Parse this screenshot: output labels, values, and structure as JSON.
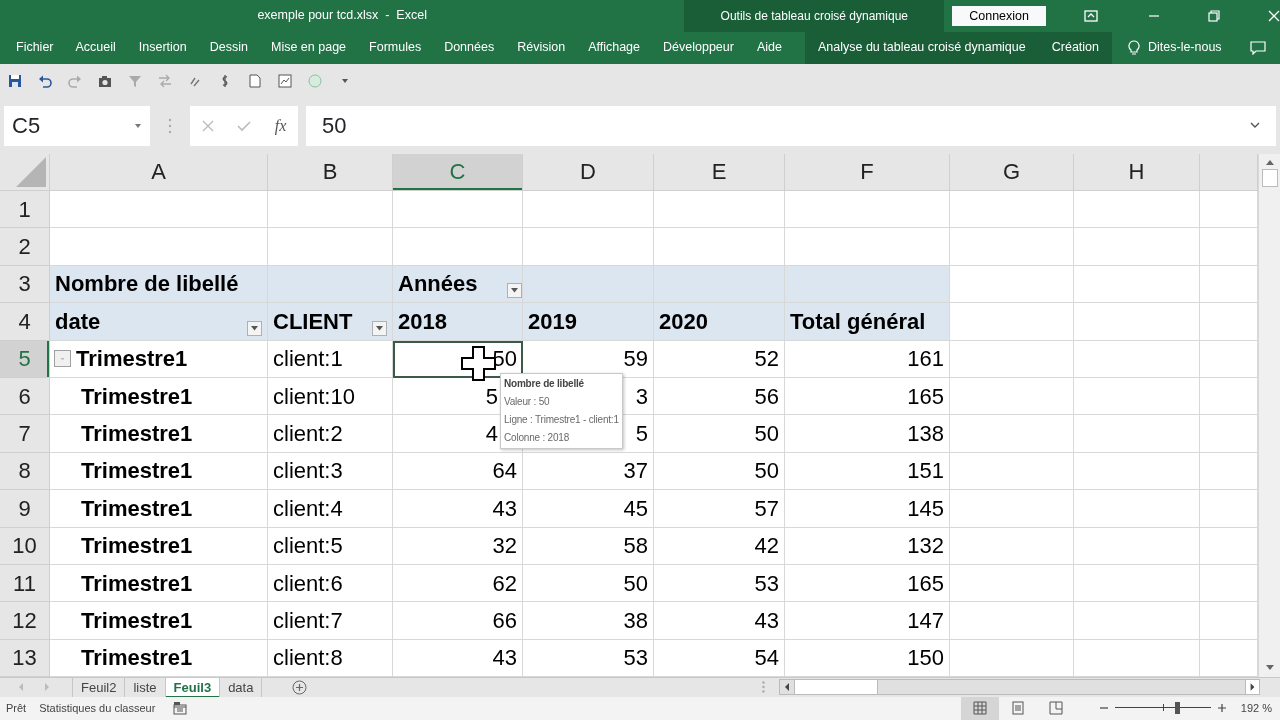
{
  "window": {
    "title": "exemple pour tcd.xlsx  -  Excel",
    "context_title": "Outils de tableau croisé dynamique",
    "sign_in": "Connexion"
  },
  "ribbon_tabs": [
    {
      "label": "Fichier",
      "kind": "normal",
      "selected": false
    },
    {
      "label": "Accueil",
      "kind": "normal",
      "selected": false
    },
    {
      "label": "Insertion",
      "kind": "normal",
      "selected": false
    },
    {
      "label": "Dessin",
      "kind": "normal",
      "selected": false
    },
    {
      "label": "Mise en page",
      "kind": "normal",
      "selected": false
    },
    {
      "label": "Formules",
      "kind": "normal",
      "selected": false
    },
    {
      "label": "Données",
      "kind": "normal",
      "selected": false
    },
    {
      "label": "Révision",
      "kind": "normal",
      "selected": false
    },
    {
      "label": "Affichage",
      "kind": "normal",
      "selected": false
    },
    {
      "label": "Développeur",
      "kind": "normal",
      "selected": false
    },
    {
      "label": "Aide",
      "kind": "normal",
      "selected": false
    },
    {
      "label": "Analyse du tableau croisé dynamique",
      "kind": "context",
      "selected": false
    },
    {
      "label": "Création",
      "kind": "context",
      "selected": false
    }
  ],
  "tell_me": "Dites-le-nous",
  "formula_bar": {
    "name_box": "C5",
    "function_label": "fx",
    "formula": "50"
  },
  "columns": [
    {
      "label": "A",
      "selected": false
    },
    {
      "label": "B",
      "selected": false
    },
    {
      "label": "C",
      "selected": true
    },
    {
      "label": "D",
      "selected": false
    },
    {
      "label": "E",
      "selected": false
    },
    {
      "label": "F",
      "selected": false
    },
    {
      "label": "G",
      "selected": false
    },
    {
      "label": "H",
      "selected": false
    }
  ],
  "rows": [
    {
      "number": "1",
      "selected": false,
      "kind": "blank"
    },
    {
      "number": "2",
      "selected": false,
      "kind": "blank"
    },
    {
      "number": "3",
      "selected": false,
      "kind": "pivot_top",
      "title": "Nombre de libellé",
      "column_field": "Années",
      "column_filter": true
    },
    {
      "number": "4",
      "selected": false,
      "kind": "pivot_labels",
      "labels": [
        {
          "text": "date",
          "filter": true
        },
        {
          "text": "CLIENT",
          "filter": true
        },
        {
          "text": "2018",
          "filter": false
        },
        {
          "text": "2019",
          "filter": false
        },
        {
          "text": "2020",
          "filter": false
        },
        {
          "text": "Total général",
          "filter": false
        }
      ]
    },
    {
      "number": "5",
      "selected": true,
      "kind": "data",
      "expander": true,
      "label": "Trimestre1",
      "client": "client:1",
      "values": [
        {
          "text": "50",
          "selected": true,
          "covered": false
        },
        {
          "text": "59",
          "selected": false,
          "covered": false
        },
        {
          "text": "52",
          "selected": false,
          "covered": false
        },
        {
          "text": "161",
          "selected": false,
          "covered": false
        }
      ]
    },
    {
      "number": "6",
      "selected": false,
      "kind": "data",
      "expander": false,
      "label": "Trimestre1",
      "client": "client:10",
      "values": [
        {
          "text": "5",
          "selected": false,
          "covered": true
        },
        {
          "text": "3",
          "selected": false,
          "covered": false
        },
        {
          "text": "56",
          "selected": false,
          "covered": false
        },
        {
          "text": "165",
          "selected": false,
          "covered": false
        }
      ]
    },
    {
      "number": "7",
      "selected": false,
      "kind": "data",
      "expander": false,
      "label": "Trimestre1",
      "client": "client:2",
      "values": [
        {
          "text": "4",
          "selected": false,
          "covered": true
        },
        {
          "text": "5",
          "selected": false,
          "covered": false
        },
        {
          "text": "50",
          "selected": false,
          "covered": false
        },
        {
          "text": "138",
          "selected": false,
          "covered": false
        }
      ]
    },
    {
      "number": "8",
      "selected": false,
      "kind": "data",
      "expander": false,
      "label": "Trimestre1",
      "client": "client:3",
      "values": [
        {
          "text": "64",
          "selected": false,
          "covered": false
        },
        {
          "text": "37",
          "selected": false,
          "covered": false
        },
        {
          "text": "50",
          "selected": false,
          "covered": false
        },
        {
          "text": "151",
          "selected": false,
          "covered": false
        }
      ]
    },
    {
      "number": "9",
      "selected": false,
      "kind": "data",
      "expander": false,
      "label": "Trimestre1",
      "client": "client:4",
      "values": [
        {
          "text": "43",
          "selected": false,
          "covered": false
        },
        {
          "text": "45",
          "selected": false,
          "covered": false
        },
        {
          "text": "57",
          "selected": false,
          "covered": false
        },
        {
          "text": "145",
          "selected": false,
          "covered": false
        }
      ]
    },
    {
      "number": "10",
      "selected": false,
      "kind": "data",
      "expander": false,
      "label": "Trimestre1",
      "client": "client:5",
      "values": [
        {
          "text": "32",
          "selected": false,
          "covered": false
        },
        {
          "text": "58",
          "selected": false,
          "covered": false
        },
        {
          "text": "42",
          "selected": false,
          "covered": false
        },
        {
          "text": "132",
          "selected": false,
          "covered": false
        }
      ]
    },
    {
      "number": "11",
      "selected": false,
      "kind": "data",
      "expander": false,
      "label": "Trimestre1",
      "client": "client:6",
      "values": [
        {
          "text": "62",
          "selected": false,
          "covered": false
        },
        {
          "text": "50",
          "selected": false,
          "covered": false
        },
        {
          "text": "53",
          "selected": false,
          "covered": false
        },
        {
          "text": "165",
          "selected": false,
          "covered": false
        }
      ]
    },
    {
      "number": "12",
      "selected": false,
      "kind": "data",
      "expander": false,
      "label": "Trimestre1",
      "client": "client:7",
      "values": [
        {
          "text": "66",
          "selected": false,
          "covered": false
        },
        {
          "text": "38",
          "selected": false,
          "covered": false
        },
        {
          "text": "43",
          "selected": false,
          "covered": false
        },
        {
          "text": "147",
          "selected": false,
          "covered": false
        }
      ]
    },
    {
      "number": "13",
      "selected": false,
      "kind": "data",
      "expander": false,
      "label": "Trimestre1",
      "client": "client:8",
      "values": [
        {
          "text": "43",
          "selected": false,
          "covered": false
        },
        {
          "text": "53",
          "selected": false,
          "covered": false
        },
        {
          "text": "54",
          "selected": false,
          "covered": false
        },
        {
          "text": "150",
          "selected": false,
          "covered": false
        }
      ]
    }
  ],
  "tooltip": {
    "title": "Nombre de libellé",
    "lines": [
      "Valeur : 50",
      "Ligne : Trimestre1 - client:1",
      "Colonne : 2018"
    ]
  },
  "sheet_tabs": [
    {
      "label": "Feuil2",
      "selected": false
    },
    {
      "label": "liste",
      "selected": false
    },
    {
      "label": "Feuil3",
      "selected": true
    },
    {
      "label": "data",
      "selected": false
    }
  ],
  "status_bar": {
    "mode": "Prêt",
    "stats": "Statistiques du classeur",
    "views": [
      {
        "kind": "normal",
        "selected": true
      },
      {
        "kind": "page_layout",
        "selected": false
      },
      {
        "kind": "page_break",
        "selected": false
      }
    ],
    "zoom": {
      "level": 0.65,
      "reading": "192 %"
    }
  }
}
